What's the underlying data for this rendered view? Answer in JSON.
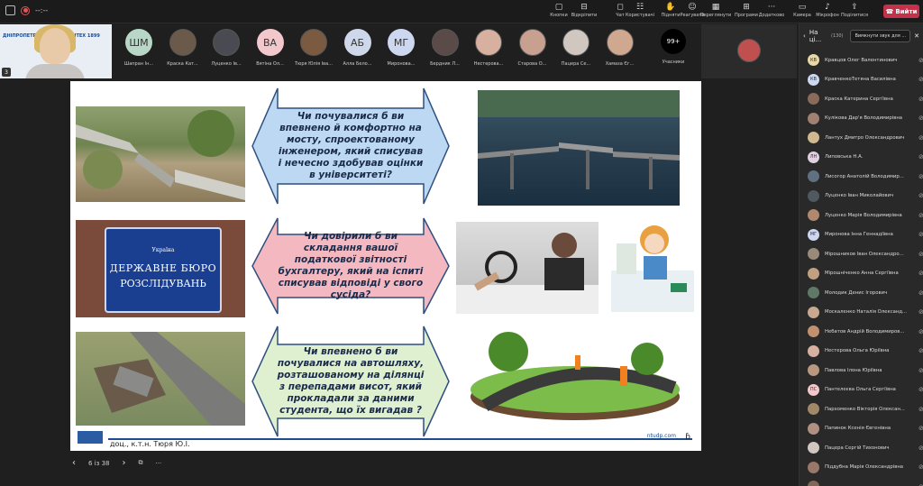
{
  "window": {
    "timer": "--:--"
  },
  "toolbar": [
    {
      "label": "Кнопки",
      "icon": "reactions-icon"
    },
    {
      "label": "Відкріпити",
      "icon": "unpin-icon"
    },
    {
      "label": "Чат",
      "icon": "chat-icon"
    },
    {
      "label": "Користувачі",
      "icon": "people-icon"
    },
    {
      "label": "Підняти",
      "icon": "raise-hand-icon"
    },
    {
      "label": "Реагувати",
      "icon": "react-icon"
    },
    {
      "label": "Переглянути",
      "icon": "view-icon"
    },
    {
      "label": "Програми",
      "icon": "apps-icon"
    },
    {
      "label": "Додатково",
      "icon": "more-icon"
    },
    {
      "label": "Камера",
      "icon": "camera-icon"
    },
    {
      "label": "Мікрофон",
      "icon": "mic-icon"
    },
    {
      "label": "Поділитися",
      "icon": "share-icon"
    }
  ],
  "leave_label": "Вийти",
  "presenter": {
    "logo_text": "ДНІПРОПЕТРОВСЬКИЙ ПОЛІТЕХ 1899",
    "badge": "3"
  },
  "participants": [
    {
      "initials": "ШМ",
      "name": "Шапран Ін...",
      "color": "#b9d7c7",
      "photo": false
    },
    {
      "initials": "",
      "name": "Краска Кат...",
      "color": "#6b5a4a",
      "photo": true
    },
    {
      "initials": "",
      "name": "Луценко Ів...",
      "color": "#4a4a52",
      "photo": true
    },
    {
      "initials": "ВА",
      "name": "Вятіна Ол...",
      "color": "#f2c8cc",
      "photo": false
    },
    {
      "initials": "",
      "name": "Тюря Юлія Іва...",
      "color": "#7a5a40",
      "photo": true
    },
    {
      "initials": "АБ",
      "name": "Алла Бело...",
      "color": "#cfd8ea",
      "photo": false
    },
    {
      "initials": "МГ",
      "name": "Миронова...",
      "color": "#cdd7ef",
      "photo": false
    },
    {
      "initials": "",
      "name": "Бердник Л...",
      "color": "#5a4a48",
      "photo": true
    },
    {
      "initials": "",
      "name": "Нестерова...",
      "color": "#d8b0a0",
      "photo": true
    },
    {
      "initials": "",
      "name": "Старова О...",
      "color": "#c8a090",
      "photo": true
    },
    {
      "initials": "",
      "name": "Пацера Се...",
      "color": "#d0c8c0",
      "photo": true
    },
    {
      "initials": "",
      "name": "Хамаза Єг...",
      "color": "#d0a890",
      "photo": true
    }
  ],
  "more_participants": {
    "count": "99+",
    "label": "Учасники"
  },
  "slide": {
    "questions": [
      "Чи почувалися б ви впевнено й комфортно на мосту, спроектованому інженером, який списував і нечесно здобував оцінки в університеті?",
      "Чи довірили б ви складання вашої податкової звітності бухгалтеру, який на іспиті списував відповіді у свого сусіда?",
      "Чи впевнено б ви почувалися на автошляху, розташованому на ділянці з перепадами висот, який прокладали за даними студента, що їх вигадав ?"
    ],
    "sign": {
      "line1": "Україна",
      "line2": "ДЕРЖАВНЕ БЮРО",
      "line3": "РОЗСЛІДУВАНЬ"
    },
    "footer_author": "доц., к.т.н. Тюря Ю.І.",
    "footer_url": "ntudp.com",
    "colors": {
      "q1": "#bcd8f2",
      "q2": "#f4b9c0",
      "q3": "#dff0d0",
      "accent": "#1e4c8c"
    }
  },
  "pager": {
    "text": "6 із 38"
  },
  "panel": {
    "title": "На ці...",
    "count": "(130)",
    "mute_all": "Вимкнути звук для ...",
    "people": [
      {
        "initials": "КВ",
        "name": "Кравцов Олег Валентинович",
        "color": "#e8d8a8"
      },
      {
        "initials": "КВ",
        "name": "КравченкоТетяна Василівна",
        "color": "#cbd8f0"
      },
      {
        "initials": "",
        "name": "Краска Катерина Сергіївна",
        "color": "#8a6a5a"
      },
      {
        "initials": "",
        "name": "Кулікова Дар'я Володимирівна",
        "color": "#a08070"
      },
      {
        "initials": "",
        "name": "Лантух Дмитро Олександрович",
        "color": "#d0b890"
      },
      {
        "initials": "ЛН",
        "name": "Липовська Н.А.",
        "color": "#e0d0e0"
      },
      {
        "initials": "",
        "name": "Лисогор Анатолій Володимир...",
        "color": "#607080"
      },
      {
        "initials": "",
        "name": "Луценко Іван Миколайович",
        "color": "#505860"
      },
      {
        "initials": "",
        "name": "Луценко Марія Володимирівна",
        "color": "#b08870"
      },
      {
        "initials": "МГ",
        "name": "Миронова Інна Геннадіївна",
        "color": "#cdd7ef"
      },
      {
        "initials": "",
        "name": "Мірошников Іван Олександро...",
        "color": "#9a8a7a"
      },
      {
        "initials": "",
        "name": "Мірошніченко Анна Сергіївна",
        "color": "#c0a080"
      },
      {
        "initials": "",
        "name": "Молодик Денис Ігорович",
        "color": "#607868"
      },
      {
        "initials": "",
        "name": "Москаленко Наталія Олександ...",
        "color": "#c8a890"
      },
      {
        "initials": "",
        "name": "Небатов Андрій Володимиров...",
        "color": "#c09070"
      },
      {
        "initials": "",
        "name": "Нестерова Ольга Юріївна",
        "color": "#d8b0a0"
      },
      {
        "initials": "",
        "name": "Павлова Ілона Юріївна",
        "color": "#b89880"
      },
      {
        "initials": "ПС",
        "name": "Пантелеєва Ольга Сергіївна",
        "color": "#f2c8cc"
      },
      {
        "initials": "",
        "name": "Пархоменко Вікторія Олексан...",
        "color": "#a08868"
      },
      {
        "initials": "",
        "name": "Папинок Ксенія Євгенівна",
        "color": "#b09080"
      },
      {
        "initials": "",
        "name": "Пацера Сергій Тихонович",
        "color": "#d0c8c0"
      },
      {
        "initials": "",
        "name": "Піддубна Марія Олександрівна",
        "color": "#987868"
      },
      {
        "initials": "",
        "name": "...",
        "color": "#806858"
      }
    ]
  }
}
